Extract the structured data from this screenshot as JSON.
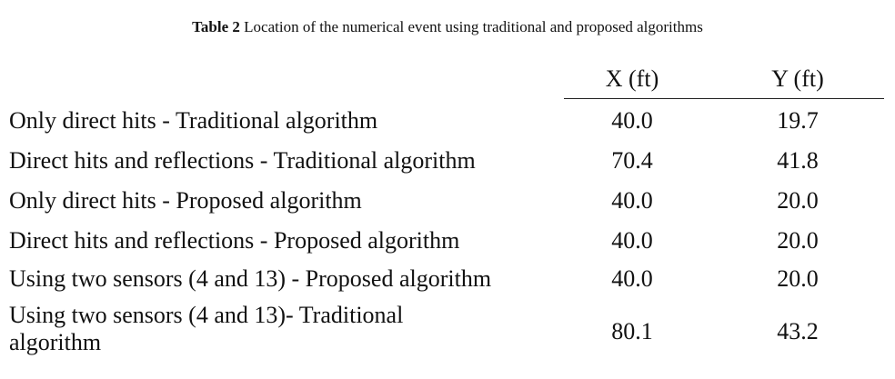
{
  "caption": {
    "label": "Table 2",
    "text": " Location of the numerical event using traditional and proposed algorithms"
  },
  "columns": {
    "x": "X (ft)",
    "y": "Y (ft)"
  },
  "rows": [
    {
      "label": "Only direct hits - Traditional algorithm",
      "x": "40.0",
      "y": "19.7"
    },
    {
      "label": "Direct hits and reflections  - Traditional algorithm",
      "x": "70.4",
      "y": "41.8"
    },
    {
      "label": "Only direct hits - Proposed algorithm",
      "x": "40.0",
      "y": "20.0"
    },
    {
      "label": "Direct hits and reflections  - Proposed algorithm",
      "x": "40.0",
      "y": "20.0"
    },
    {
      "label": "Using two sensors (4 and 13) - Proposed algorithm",
      "x": "40.0",
      "y": "20.0"
    },
    {
      "label": "Using two sensors (4 and 13)- Traditional algorithm",
      "x": "80.1",
      "y": "43.2"
    }
  ]
}
